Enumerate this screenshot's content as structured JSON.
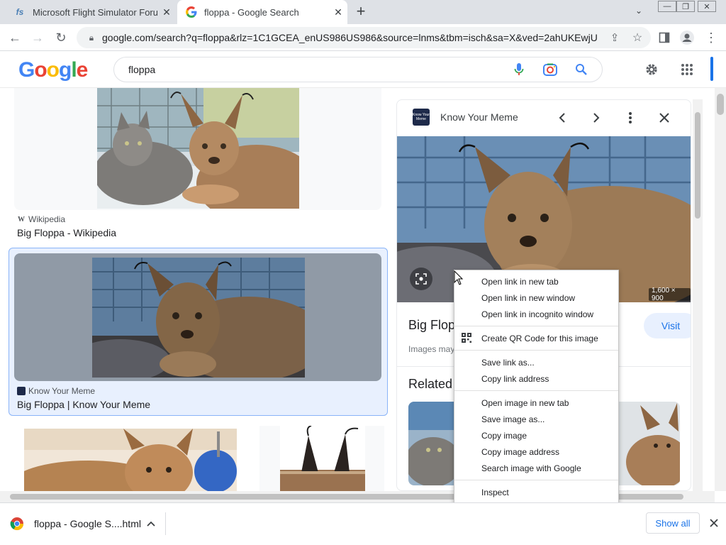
{
  "tabs": [
    {
      "title": "Microsoft Flight Simulator Forum",
      "favicon": "fs-icon"
    },
    {
      "title": "floppa - Google Search",
      "favicon": "google-g-icon"
    }
  ],
  "address_bar": {
    "url": "google.com/search?q=floppa&rlz=1C1GCEA_enUS986US986&source=lnms&tbm=isch&sa=X&ved=2ahUKEwjU..."
  },
  "google": {
    "logo": [
      "G",
      "o",
      "o",
      "g",
      "l",
      "e"
    ],
    "logo_colors": [
      "#4285f4",
      "#ea4335",
      "#fbbc05",
      "#4285f4",
      "#34a853",
      "#ea4335"
    ],
    "query": "floppa"
  },
  "results": [
    {
      "source": "Wikipedia",
      "title": "Big Floppa - Wikipedia"
    },
    {
      "source": "Know Your Meme",
      "title": "Big Floppa | Know Your Meme"
    }
  ],
  "panel": {
    "source": "Know Your Meme",
    "source_logo_text": "Know Your Meme",
    "dimensions": "1,600 × 900",
    "title_partial": "Big Flop",
    "visit_label": "Visit",
    "copyright_partial": "Images may",
    "related_label": "Related"
  },
  "context_menu": {
    "group1": [
      "Open link in new tab",
      "Open link in new window",
      "Open link in incognito window"
    ],
    "group2": [
      "Create QR Code for this image"
    ],
    "group3": [
      "Save link as...",
      "Copy link address"
    ],
    "group4": [
      "Open image in new tab",
      "Save image as...",
      "Copy image",
      "Copy image address",
      "Search image with Google"
    ],
    "group5": [
      "Inspect"
    ]
  },
  "download": {
    "filename": "floppa - Google S....html",
    "show_all_label": "Show all"
  },
  "colors": {
    "accent": "#1a73e8",
    "selected_bg": "#e8f0fe"
  }
}
